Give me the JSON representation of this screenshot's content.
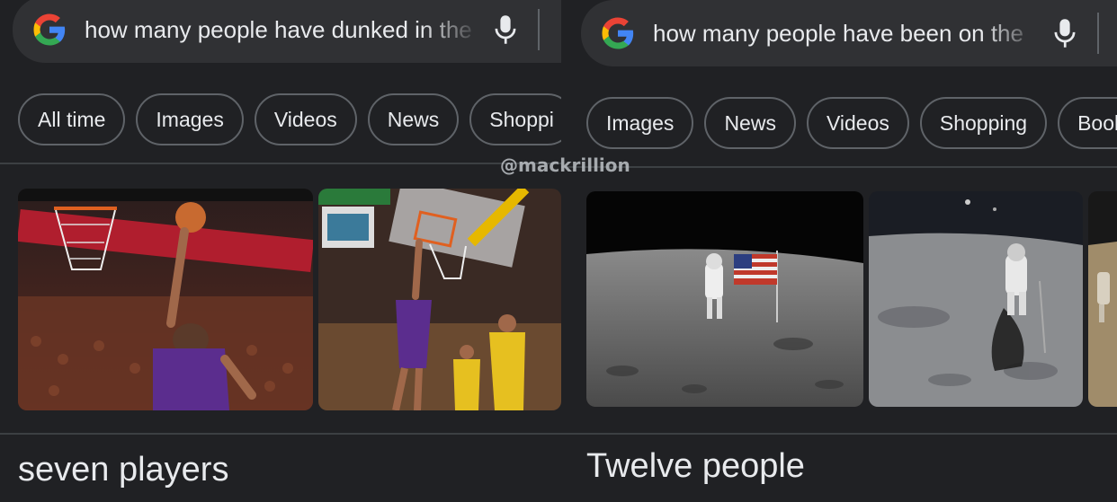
{
  "watermark": "@mackrillion",
  "left": {
    "query": "how many people have dunked in the",
    "chips": [
      "All time",
      "Images",
      "Videos",
      "News",
      "Shoppi"
    ],
    "answer": "seven players",
    "images": [
      "basketball-dunk-photo-1",
      "basketball-dunk-photo-2"
    ]
  },
  "right": {
    "query": "how many people have been on the",
    "chips": [
      "Images",
      "News",
      "Videos",
      "Shopping",
      "Book"
    ],
    "answer": "Twelve people",
    "images": [
      "moon-landing-flag-photo",
      "moon-astronaut-photo",
      "moon-partial-photo"
    ]
  },
  "colors": {
    "background": "#202124",
    "searchbar": "#303134",
    "chip_border": "#5f6368",
    "text": "#e8eaed"
  }
}
